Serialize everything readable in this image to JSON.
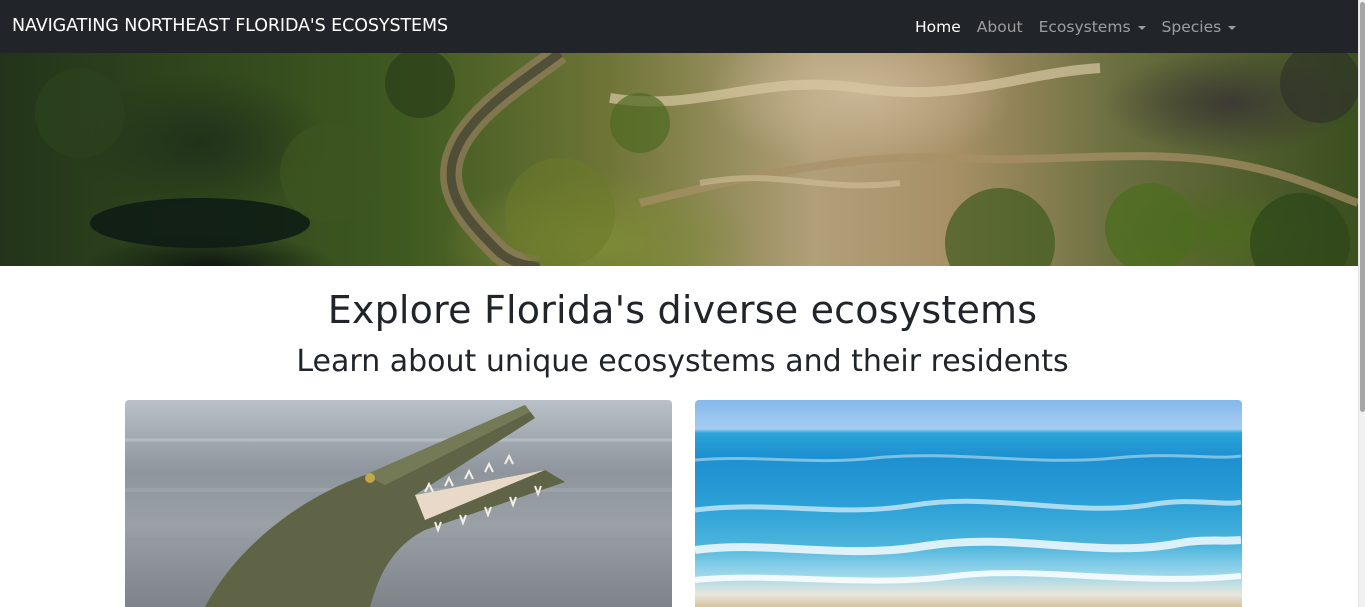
{
  "navbar": {
    "brand": "NAVIGATING NORTHEAST FLORIDA'S ECOSYSTEMS",
    "links": [
      {
        "label": "Home",
        "active": true
      },
      {
        "label": "About",
        "active": false
      },
      {
        "label": "Ecosystems",
        "dropdown": true
      },
      {
        "label": "Species",
        "dropdown": true
      }
    ]
  },
  "hero": {
    "image": "aerial-marsh-river-photo"
  },
  "main": {
    "title": "Explore Florida's diverse ecosystems",
    "subtitle": "Learn about unique ecosystems and their residents"
  },
  "cards": [
    {
      "image": "crocodile-photo"
    },
    {
      "image": "ocean-beach-photo"
    }
  ],
  "colors": {
    "navbar_bg": "#212529",
    "nav_active": "#ffffff",
    "nav_inactive": "rgba(255,255,255,0.55)",
    "text": "#212529"
  }
}
